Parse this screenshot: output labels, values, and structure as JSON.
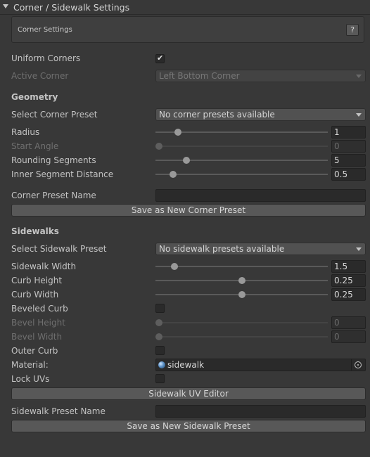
{
  "header": {
    "title": "Corner / Sidewalk Settings"
  },
  "help": {
    "text": "Corner Settings",
    "button": "?"
  },
  "corner": {
    "uniform_label": "Uniform Corners",
    "uniform_checked": true,
    "active_label": "Active Corner",
    "active_value": "Left Bottom Corner"
  },
  "geometry": {
    "title": "Geometry",
    "preset_label": "Select Corner Preset",
    "preset_value": "No corner presets available",
    "radius": {
      "label": "Radius",
      "value": "1",
      "fraction": 0.13
    },
    "start_angle": {
      "label": "Start Angle",
      "value": "0",
      "fraction": 0.02
    },
    "rounding": {
      "label": "Rounding Segments",
      "value": "5",
      "fraction": 0.18
    },
    "inner": {
      "label": "Inner Segment Distance",
      "value": "0.5",
      "fraction": 0.1
    },
    "name_label": "Corner Preset Name",
    "save_button": "Save as New Corner Preset"
  },
  "sidewalks": {
    "title": "Sidewalks",
    "preset_label": "Select Sidewalk Preset",
    "preset_value": "No sidewalk presets available",
    "width": {
      "label": "Sidewalk Width",
      "value": "1.5",
      "fraction": 0.11
    },
    "curb_height": {
      "label": "Curb Height",
      "value": "0.25",
      "fraction": 0.5
    },
    "curb_width": {
      "label": "Curb Width",
      "value": "0.25",
      "fraction": 0.5
    },
    "beveled_label": "Beveled Curb",
    "beveled_checked": false,
    "bevel_height": {
      "label": "Bevel Height",
      "value": "0",
      "fraction": 0.02
    },
    "bevel_width": {
      "label": "Bevel Width",
      "value": "0",
      "fraction": 0.02
    },
    "outer_label": "Outer Curb",
    "outer_checked": false,
    "material_label": "Material:",
    "material_value": "sidewalk",
    "lock_label": "Lock UVs",
    "lock_checked": false,
    "uv_button": "Sidewalk UV Editor",
    "name_label": "Sidewalk Preset Name",
    "save_button": "Save as New Sidewalk Preset"
  },
  "colors": {
    "background": "#383838",
    "field": "#2a2a2a",
    "button": "#585858"
  }
}
